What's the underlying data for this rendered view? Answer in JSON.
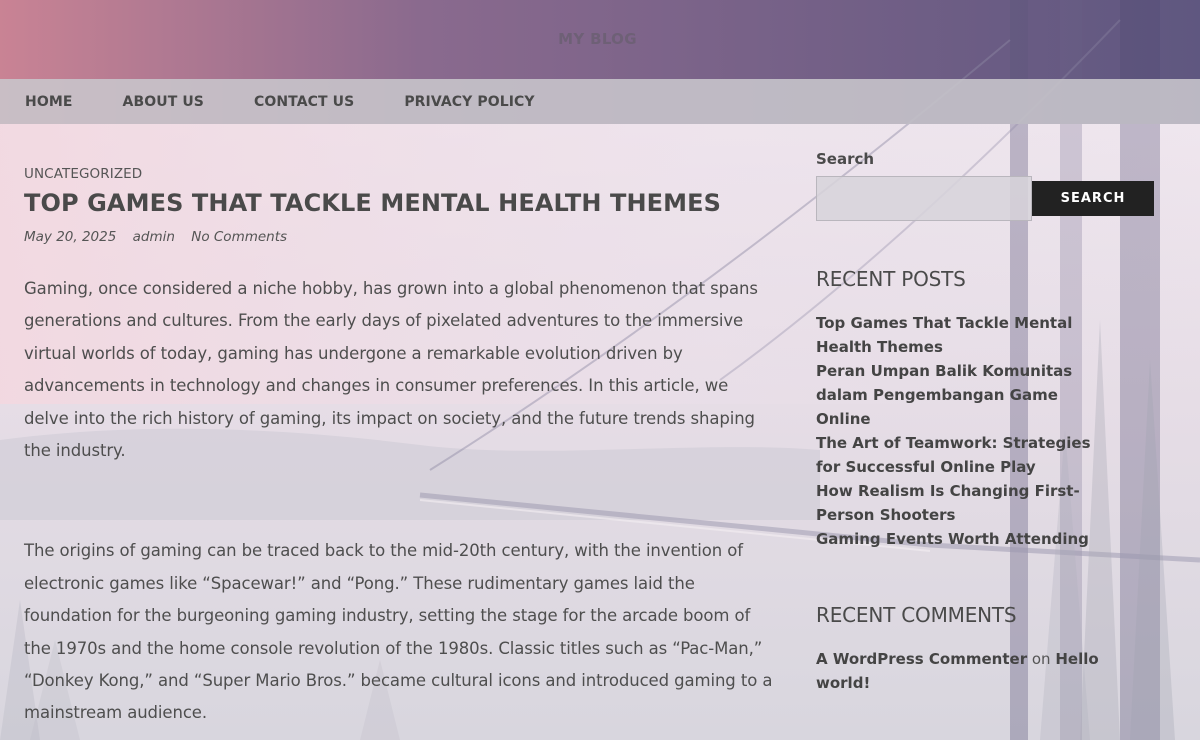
{
  "header": {
    "site_title": "MY BLOG"
  },
  "nav": {
    "items": [
      {
        "label": "HOME"
      },
      {
        "label": "ABOUT US"
      },
      {
        "label": "CONTACT US"
      },
      {
        "label": "PRIVACY POLICY"
      }
    ]
  },
  "post": {
    "category": "UNCATEGORIZED",
    "title": "TOP GAMES THAT TACKLE MENTAL HEALTH THEMES",
    "date": "May 20, 2025",
    "author": "admin",
    "comments": "No Comments",
    "paragraphs": [
      "Gaming, once considered a niche hobby, has grown into a global phenomenon that spans generations and cultures. From the early days of pixelated adventures to the immersive virtual worlds of today, gaming has undergone a remarkable evolution driven by advancements in technology and changes in consumer preferences. In this article, we delve into the rich history of gaming, its impact on society, and the future trends shaping the industry.",
      "The origins of gaming can be traced back to the mid-20th century, with the invention of electronic games like “Spacewar!” and “Pong.” These rudimentary games laid the foundation for the burgeoning gaming industry, setting the stage for the arcade boom of the 1970s and the home console revolution of the 1980s. Classic titles such as “Pac-Man,” “Donkey Kong,” and “Super Mario Bros.” became cultural icons and introduced gaming to a mainstream audience."
    ]
  },
  "sidebar": {
    "search": {
      "label": "Search",
      "placeholder": "",
      "value": "",
      "button_label": "SEARCH"
    },
    "recent_posts": {
      "title": "RECENT POSTS",
      "items": [
        "Top Games That Tackle Mental Health Themes",
        "Peran Umpan Balik Komunitas dalam Pengembangan Game Online",
        "The Art of Teamwork: Strategies for Successful Online Play",
        "How Realism Is Changing First-Person Shooters",
        "Gaming Events Worth Attending"
      ]
    },
    "recent_comments": {
      "title": "RECENT COMMENTS",
      "items": [
        {
          "author": "A WordPress Commenter",
          "on": "on",
          "post": "Hello world!"
        }
      ]
    }
  },
  "colors": {
    "sky_top": "#6e5a86",
    "sky_sunset": "#d98a98",
    "nav_bg": "#c8c6cc",
    "text": "#4a4a4a",
    "button_bg": "#222222"
  }
}
